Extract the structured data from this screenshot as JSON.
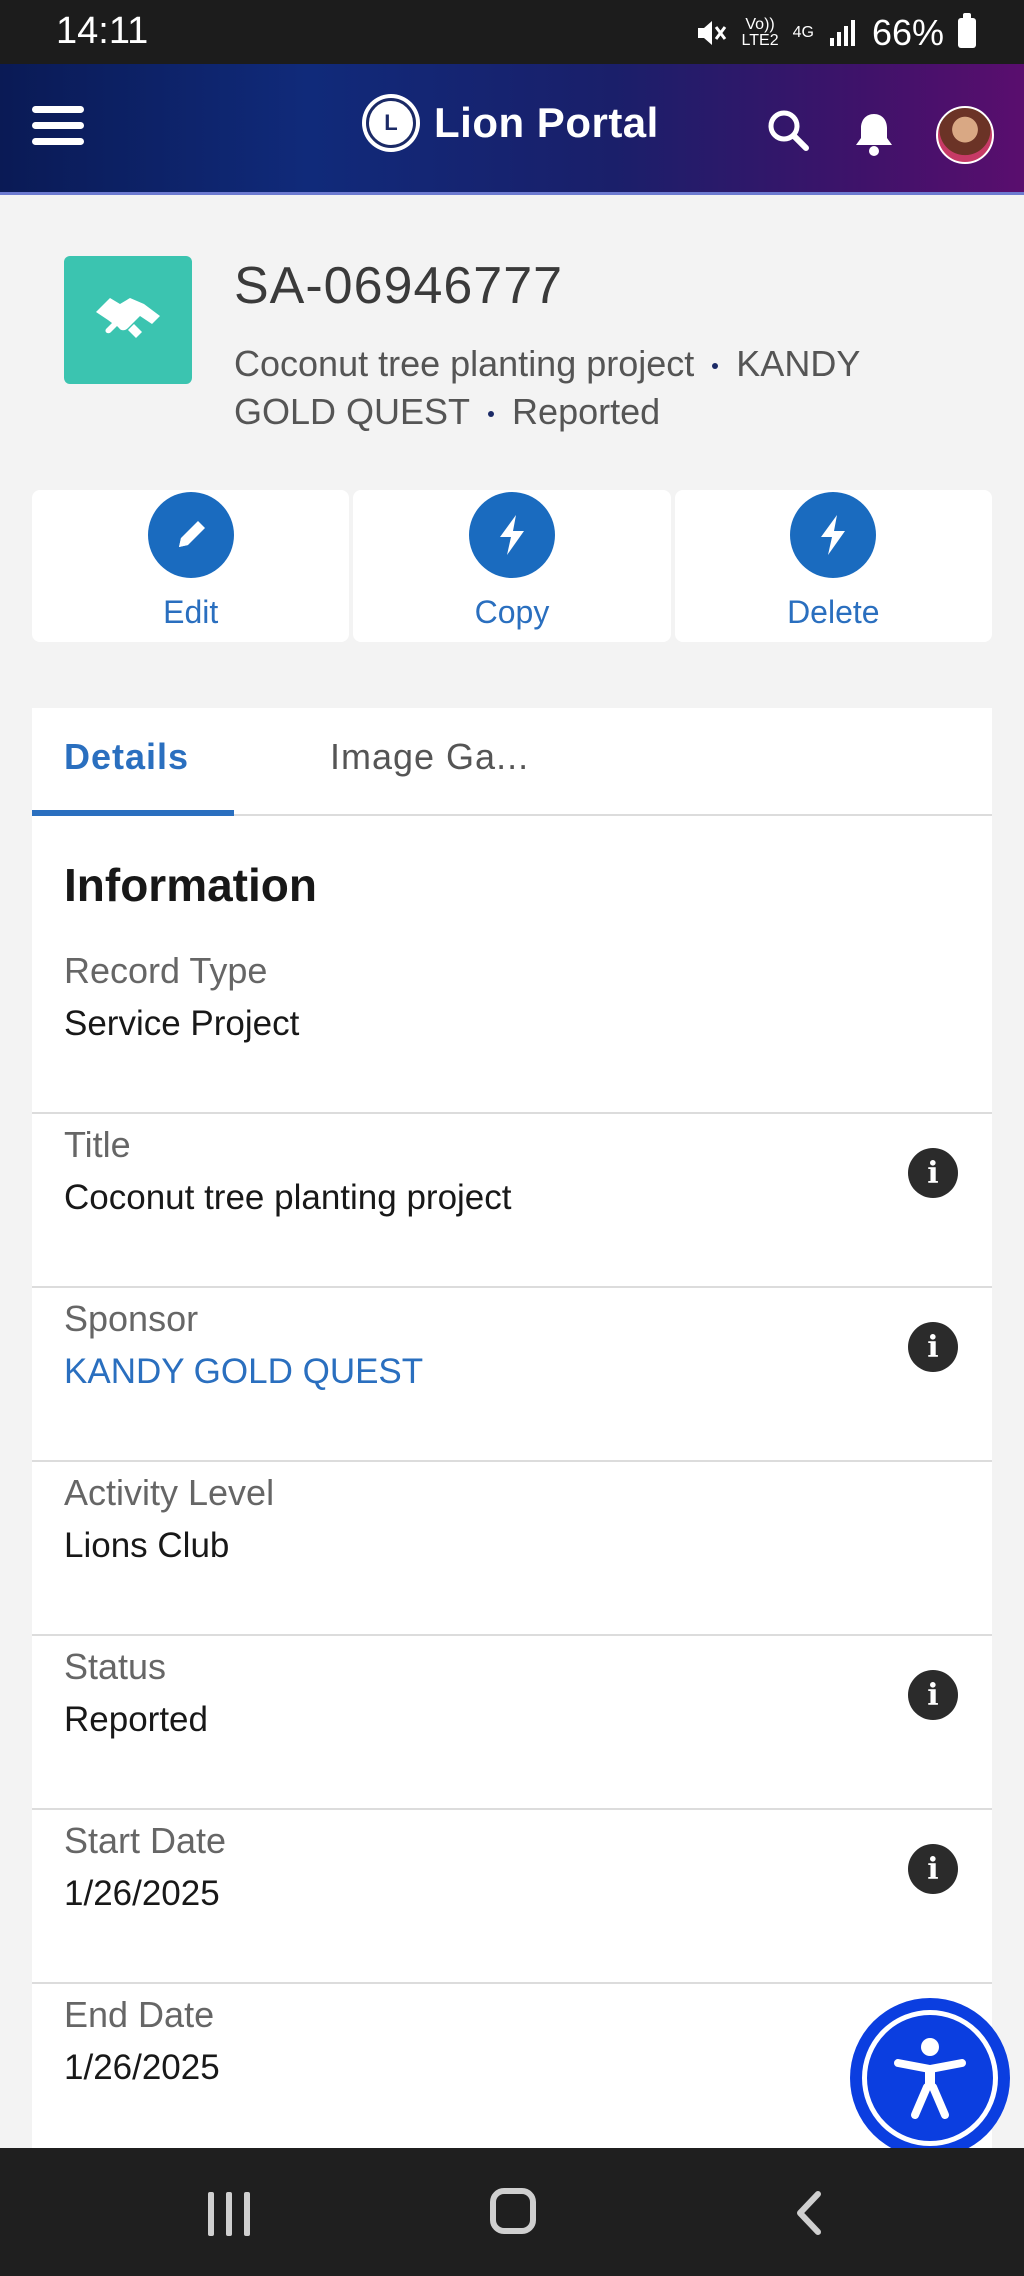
{
  "status_bar": {
    "time": "14:11",
    "net_top": "Vo))",
    "net_bottom": "LTE2",
    "net_type": "4G",
    "battery": "66%"
  },
  "header": {
    "app_name": "Lion Portal",
    "logo_letter": "L"
  },
  "record": {
    "id": "SA-06946777",
    "title": "Coconut tree planting project",
    "sponsor": "KANDY GOLD QUEST",
    "status": "Reported",
    "icon_color": "#3bc4b0"
  },
  "actions": [
    {
      "label": "Edit",
      "icon": "pencil-icon"
    },
    {
      "label": "Copy",
      "icon": "lightning-icon"
    },
    {
      "label": "Delete",
      "icon": "lightning-icon"
    }
  ],
  "tabs": [
    {
      "label": "Details",
      "active": true
    },
    {
      "label": "Image Ga...",
      "active": false
    }
  ],
  "section": {
    "title": "Information"
  },
  "fields": [
    {
      "label": "Record Type",
      "value": "Service Project",
      "info": false
    },
    {
      "label": "Title",
      "value": "Coconut tree planting project",
      "info": true
    },
    {
      "label": "Sponsor",
      "value": "KANDY GOLD QUEST",
      "info": true,
      "link": true
    },
    {
      "label": "Activity Level",
      "value": "Lions Club",
      "info": false
    },
    {
      "label": "Status",
      "value": "Reported",
      "info": true
    },
    {
      "label": "Start Date",
      "value": "1/26/2025",
      "info": true
    },
    {
      "label": "End Date",
      "value": "1/26/2025",
      "info": false
    }
  ],
  "info_glyph": "i",
  "colors": {
    "accent": "#2a6fbf",
    "action_circle": "#1a6bbf",
    "fab": "#0b3ee0"
  }
}
